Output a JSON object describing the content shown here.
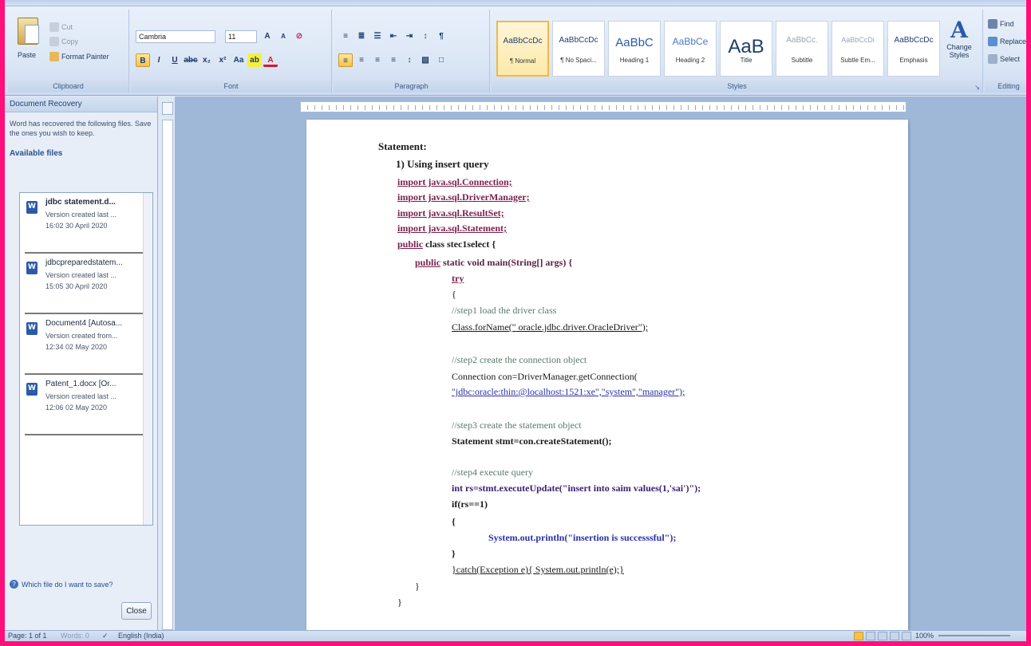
{
  "ribbon": {
    "clipboard": {
      "paste": "Paste",
      "cut": "Cut",
      "copy": "Copy",
      "format_painter": "Format Painter",
      "label": "Clipboard"
    },
    "font": {
      "font_name": "Cambria",
      "font_size": "11",
      "label": "Font"
    },
    "paragraph": {
      "label": "Paragraph"
    },
    "styles": {
      "label": "Styles",
      "items": [
        {
          "sample": "AaBbCcDc",
          "name": "¶ Normal",
          "selected": true
        },
        {
          "sample": "AaBbCcDc",
          "name": "¶ No Spaci...",
          "selected": false
        },
        {
          "sample": "AaBbC",
          "name": "Heading 1",
          "selected": false
        },
        {
          "sample": "AaBbCe",
          "name": "Heading 2",
          "selected": false
        },
        {
          "sample": "AaB",
          "name": "Title",
          "selected": false
        },
        {
          "sample": "AaBbCc.",
          "name": "Subtitle",
          "selected": false
        },
        {
          "sample": "AaBbCcDi",
          "name": "Subtle Em...",
          "selected": false
        },
        {
          "sample": "AaBbCcDc",
          "name": "Emphasis",
          "selected": false
        }
      ],
      "change_styles": "Change Styles"
    },
    "editing": {
      "find": "Find",
      "replace": "Replace",
      "select": "Select",
      "label": "Editing"
    }
  },
  "recovery": {
    "title": "Document Recovery",
    "message": "Word has recovered the following files. Save the ones you wish to keep.",
    "available_files": "Available files",
    "files": [
      {
        "name": "jdbc statement.d...",
        "line1": "Version created last ...",
        "line2": "16:02 30 April 2020"
      },
      {
        "name": "jdbcpreparedstatem...",
        "line1": "Version created last ...",
        "line2": "15:05 30 April 2020"
      },
      {
        "name": "Document4 [Autosa...",
        "line1": "Version created from...",
        "line2": "12:34 02 May 2020"
      },
      {
        "name": "Patent_1.docx [Or...",
        "line1": "Version created last ...",
        "line2": "12:06 02 May 2020"
      }
    ],
    "help_link": "Which file do I want to save?",
    "close": "Close"
  },
  "document": {
    "heading": "Statement:",
    "sub_heading": "1)  Using insert query",
    "lines": {
      "imp1": "import java.sql.Connection;",
      "imp2": "import java.sql.DriverManager;",
      "imp3": "import java.sql.ResultSet;",
      "imp4": "import java.sql.Statement;",
      "cls_kw": "public",
      "cls_rest": "class stec1select {",
      "main_kw": "public",
      "main_rest": "static void main(String[] args) {",
      "try": "try",
      "brace_open": "{",
      "c1": "//step1 load the driver class",
      "forname": "Class.forName(\" oracle.jdbc.driver.OracleDriver\");",
      "c2": "//step2 create  the connection object",
      "conn1": "Connection con=DriverManager.getConnection(",
      "conn2": "\"jdbc:oracle:thin:@localhost:1521:xe\",\"system\",\"manager\");",
      "c3": "//step3 create the statement object",
      "stmt": "Statement stmt=con.createStatement();",
      "c4": "//step4 execute query",
      "exec": "int rs=stmt.executeUpdate(\"insert into saim values(1,'sai')\");",
      "if": "if(rs==1)",
      "brace_open2": "{",
      "println": "System.out.println(\"insertion is successsful\");",
      "brace_close2": "}",
      "catch": "}catch(Exception e){ System.out.println(e);}",
      "brace_close3": "}",
      "brace_close4": "}"
    }
  },
  "status": {
    "page": "Page: 1 of 1",
    "words": "Words: 0",
    "language": "English (India)",
    "zoom": "100%"
  }
}
